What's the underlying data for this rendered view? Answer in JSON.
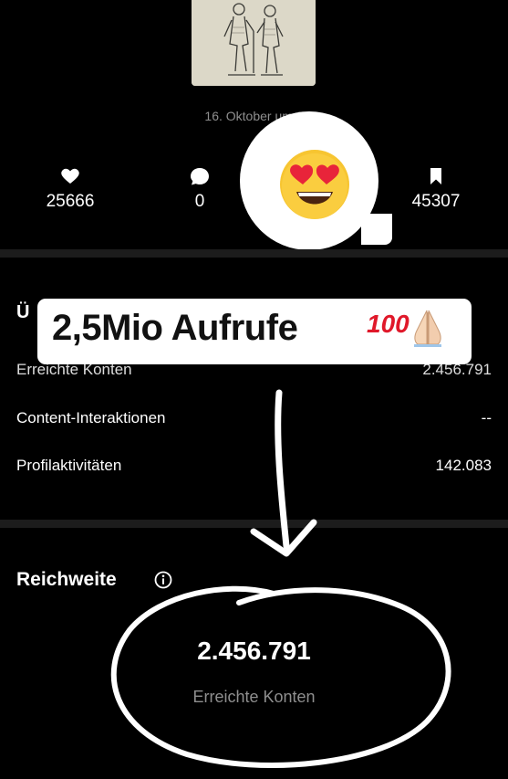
{
  "post": {
    "date": "16. Oktober um 0"
  },
  "stats": {
    "likes": "25666",
    "comments": "0",
    "saves": "45307"
  },
  "overview": {
    "heading": "Ü",
    "rows": [
      {
        "label": "Erreichte Konten",
        "value": "2.456.791"
      },
      {
        "label": "Content-Interaktionen",
        "value": "--"
      },
      {
        "label": "Profilaktivitäten",
        "value": "142.083"
      }
    ]
  },
  "sticker": {
    "text": "2,5Mio Aufrufe",
    "hundred_emoji": "100"
  },
  "reach": {
    "title": "Reichweite",
    "value": "2.456.791",
    "label": "Erreichte Konten"
  },
  "icons": [
    "heart-icon",
    "comment-icon",
    "bookmark-icon",
    "info-icon",
    "heart-eyes-emoji",
    "hundred-emoji",
    "folded-hands-emoji"
  ],
  "colors": {
    "background": "#000000",
    "muted_text": "#8e8e8e",
    "divider": "#1c1c1c",
    "sticker_bg": "#ffffff",
    "hundred_red": "#e0182a"
  }
}
